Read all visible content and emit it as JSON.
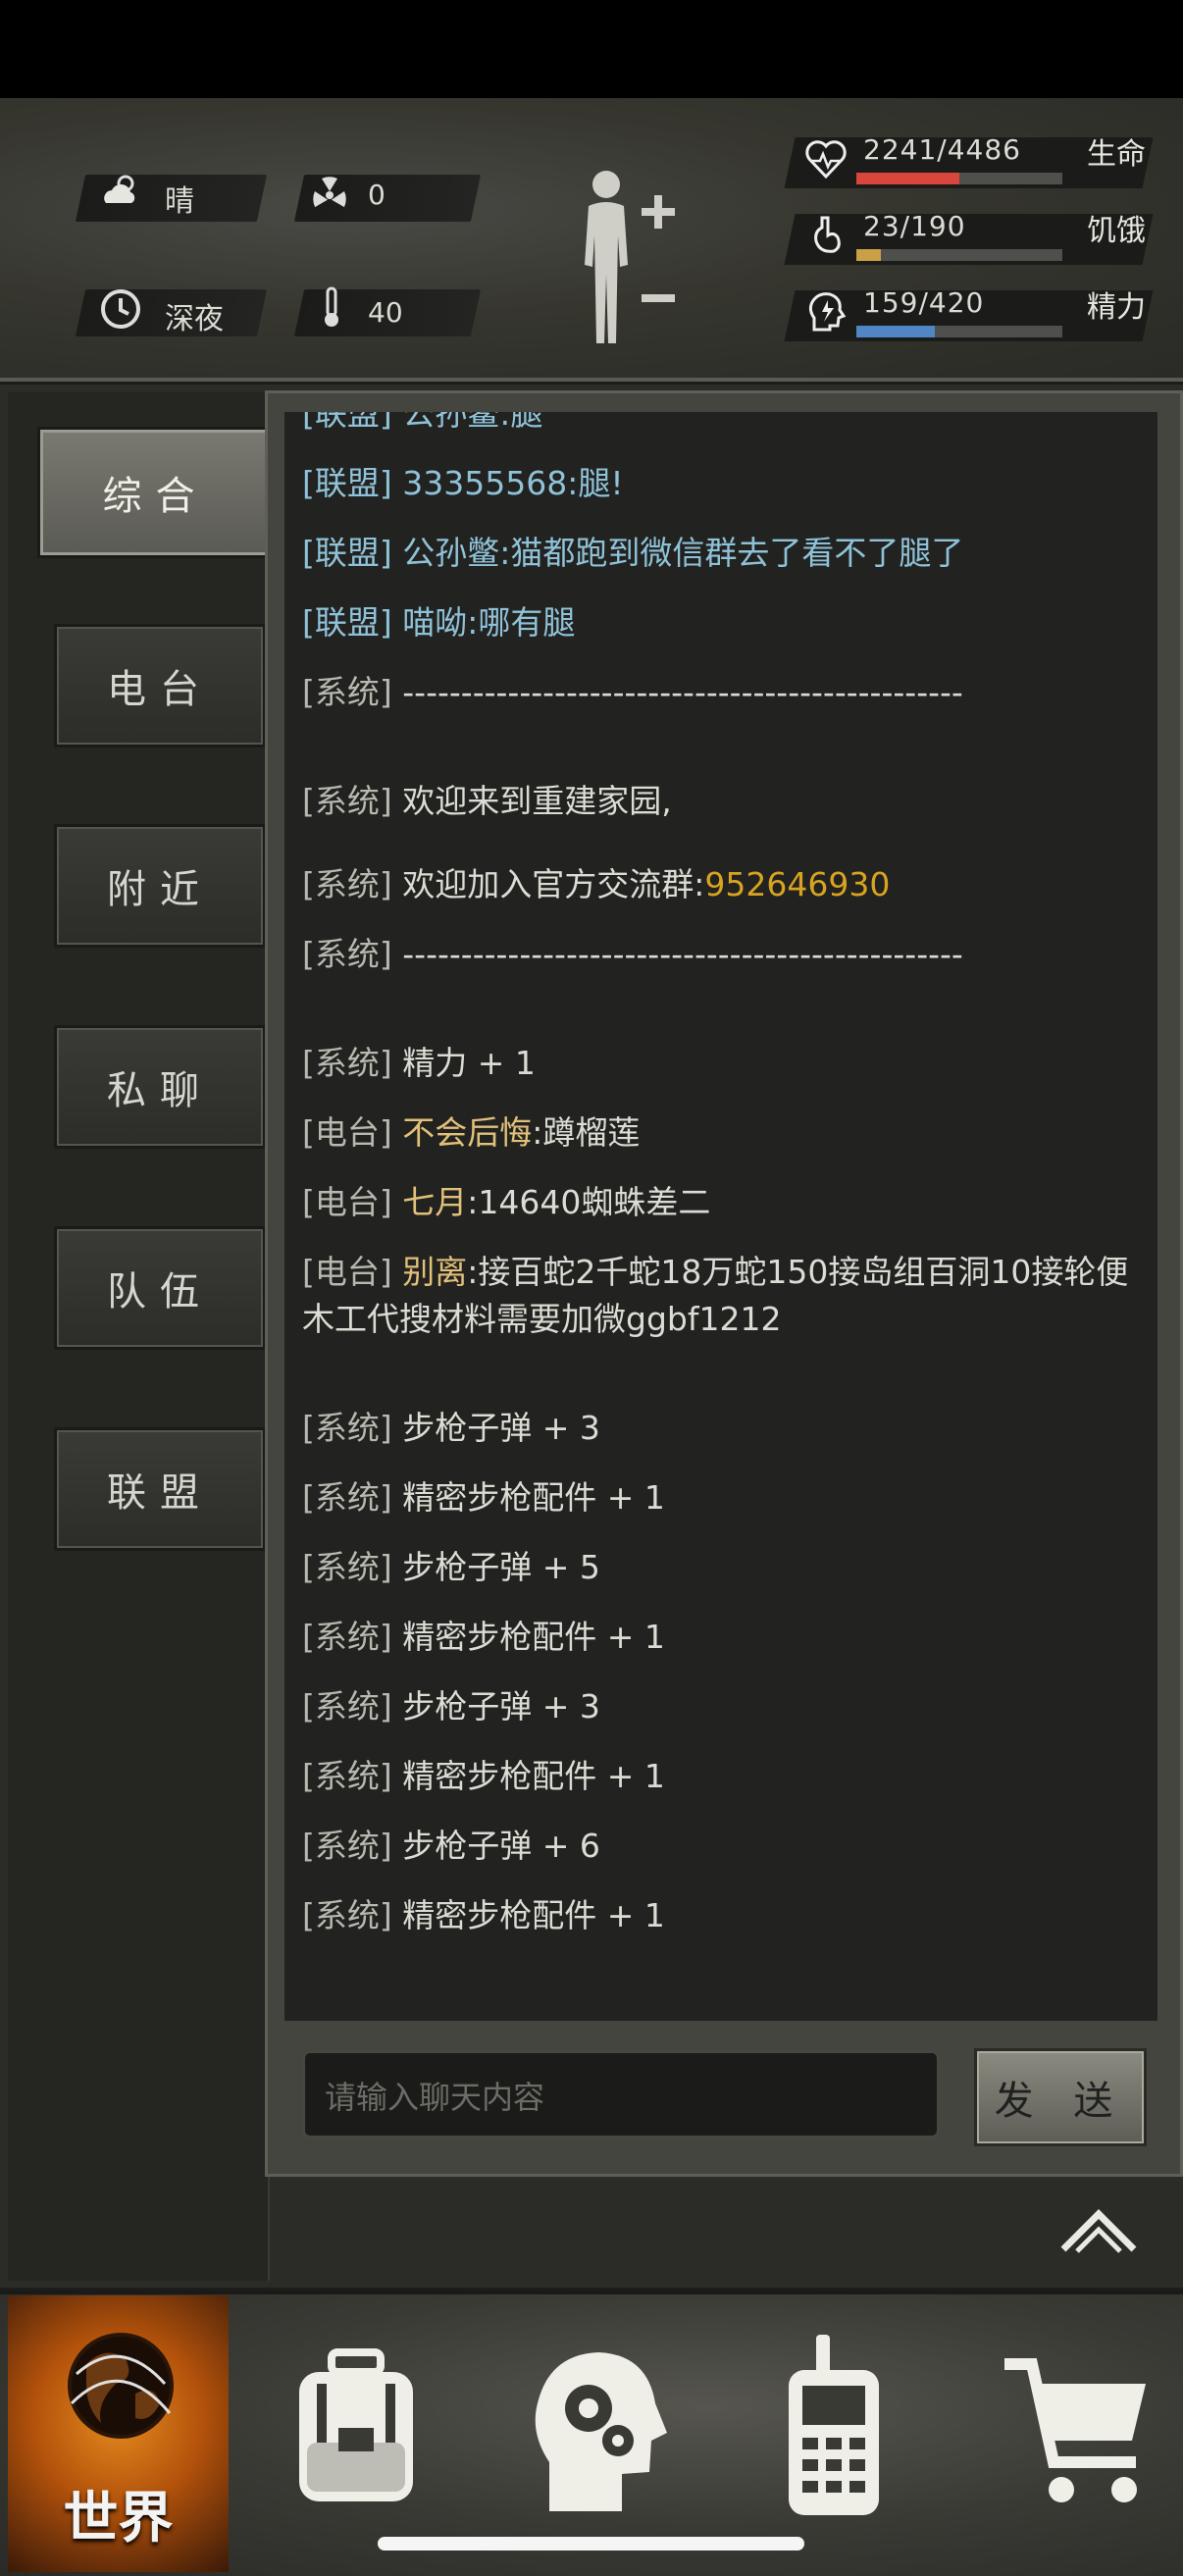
{
  "status": {
    "weather": "晴",
    "radiation": "0",
    "time_of_day": "深夜",
    "temperature": "40"
  },
  "vitals": {
    "health": {
      "value": "2241/4486",
      "label": "生命",
      "fraction": 0.5,
      "color": "#d9473c"
    },
    "hunger": {
      "value": "23/190",
      "label": "饥饿",
      "fraction": 0.12,
      "color": "#c9a046"
    },
    "energy": {
      "value": "159/420",
      "label": "精力",
      "fraction": 0.38,
      "color": "#4f86c3"
    }
  },
  "tabs": [
    {
      "label": "综合",
      "active": true
    },
    {
      "label": "电台",
      "active": false
    },
    {
      "label": "附近",
      "active": false
    },
    {
      "label": "私聊",
      "active": false
    },
    {
      "label": "队伍",
      "active": false
    },
    {
      "label": "联盟",
      "active": false
    }
  ],
  "messages": [
    {
      "tag": "[联盟]",
      "kind": "league",
      "user": "",
      "text": "公孙鳖:腿"
    },
    {
      "tag": "[联盟]",
      "kind": "league",
      "user": "",
      "text": "33355568:腿!"
    },
    {
      "tag": "[联盟]",
      "kind": "league",
      "user": "",
      "text": "公孙鳖:猫都跑到微信群去了看不了腿了"
    },
    {
      "tag": "[联盟]",
      "kind": "league",
      "user": "",
      "text": "喵呦:哪有腿"
    },
    {
      "tag": "[系统]",
      "kind": "sys",
      "user": "",
      "text": "------------------------------------------------"
    },
    {
      "tag": "[系统]",
      "kind": "sys",
      "user": "",
      "text": "欢迎来到重建家园,"
    },
    {
      "tag": "[系统]",
      "kind": "sys",
      "user": "",
      "text": " 欢迎加入官方交流群:",
      "extra": "952646930"
    },
    {
      "tag": "[系统]",
      "kind": "sys",
      "user": "",
      "text": "------------------------------------------------"
    },
    {
      "tag": "[系统]",
      "kind": "sys",
      "user": "",
      "text": "精力 + 1"
    },
    {
      "tag": "[电台]",
      "kind": "radio",
      "user": "不会后悔",
      "text": ":蹲榴莲"
    },
    {
      "tag": "[电台]",
      "kind": "radio",
      "user": "七月",
      "text": ":14640蜘蛛差二"
    },
    {
      "tag": "[电台]",
      "kind": "radio",
      "user": "别离",
      "text": ":接百蛇2千蛇18万蛇150接岛组百洞10接轮便木工代搜材料需要加微ggbf1212"
    },
    {
      "tag": "[系统]",
      "kind": "sys",
      "user": "",
      "text": "步枪子弹 + 3"
    },
    {
      "tag": "[系统]",
      "kind": "sys",
      "user": "",
      "text": "精密步枪配件 + 1"
    },
    {
      "tag": "[系统]",
      "kind": "sys",
      "user": "",
      "text": "步枪子弹 + 5"
    },
    {
      "tag": "[系统]",
      "kind": "sys",
      "user": "",
      "text": "精密步枪配件 + 1"
    },
    {
      "tag": "[系统]",
      "kind": "sys",
      "user": "",
      "text": "步枪子弹 + 3"
    },
    {
      "tag": "[系统]",
      "kind": "sys",
      "user": "",
      "text": "精密步枪配件 + 1"
    },
    {
      "tag": "[系统]",
      "kind": "sys",
      "user": "",
      "text": "步枪子弹 + 6"
    },
    {
      "tag": "[系统]",
      "kind": "sys",
      "user": "",
      "text": "精密步枪配件 + 1"
    }
  ],
  "chat_input": {
    "placeholder": "请输入聊天内容"
  },
  "send_label": "发 送",
  "bottom_nav": [
    {
      "label": "世界",
      "icon": "globe-icon",
      "active": true
    },
    {
      "label": "",
      "icon": "backpack-icon",
      "active": false
    },
    {
      "label": "",
      "icon": "brain-gear-icon",
      "active": false
    },
    {
      "label": "",
      "icon": "radio-icon",
      "active": false
    },
    {
      "label": "",
      "icon": "cart-icon",
      "active": false
    }
  ]
}
